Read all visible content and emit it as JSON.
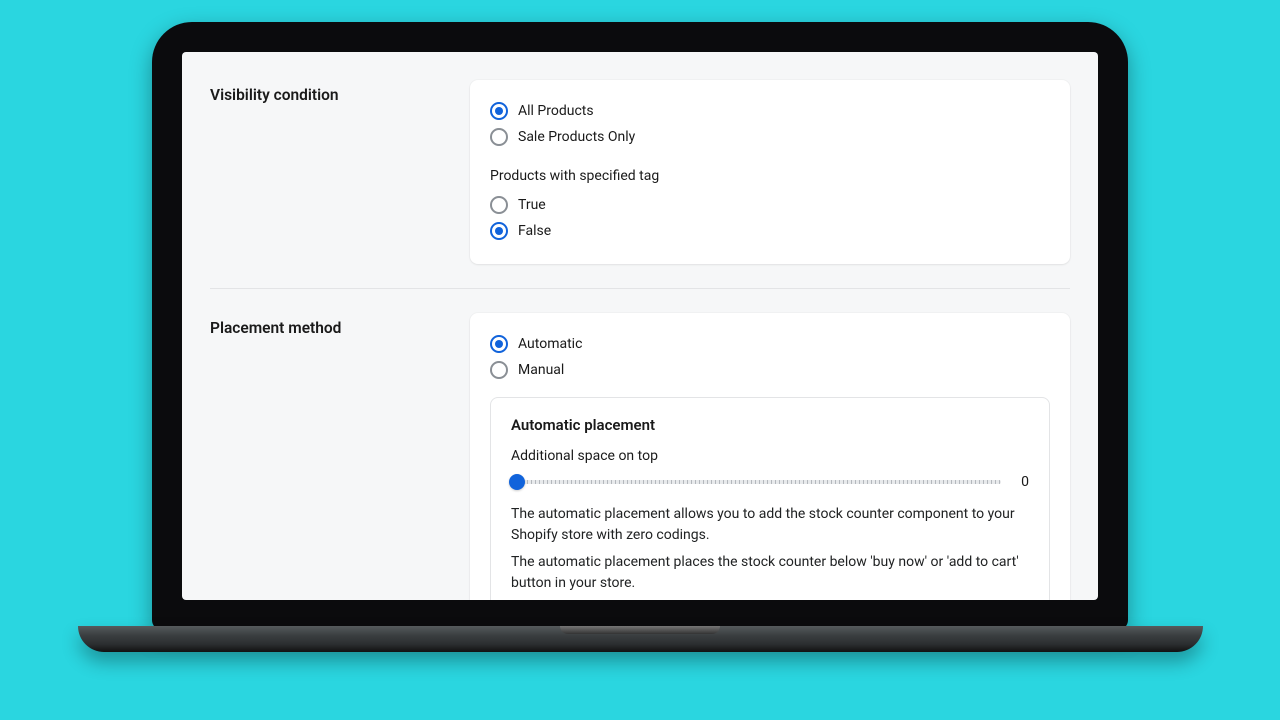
{
  "sections": {
    "visibility": {
      "title": "Visibility condition",
      "options": {
        "all": "All Products",
        "sale": "Sale Products Only"
      },
      "selected": "all",
      "tag_group_label": "Products with specified tag",
      "tag_options": {
        "true": "True",
        "false": "False"
      },
      "tag_selected": "false"
    },
    "placement": {
      "title": "Placement method",
      "options": {
        "auto": "Automatic",
        "manual": "Manual"
      },
      "selected": "auto",
      "auto_card": {
        "title": "Automatic placement",
        "spacing_label": "Additional space on top",
        "spacing_value": "0",
        "desc1": "The automatic placement allows you to add the stock counter component to your Shopify store with zero codings.",
        "desc2": "The automatic placement places the stock counter below 'buy now' or 'add to cart' button in your store."
      }
    }
  }
}
